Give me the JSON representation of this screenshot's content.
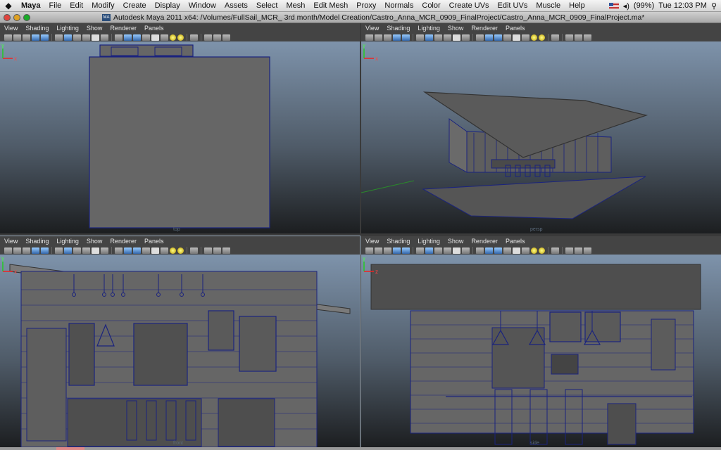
{
  "menubar": {
    "app": "Maya",
    "items": [
      "File",
      "Edit",
      "Modify",
      "Create",
      "Display",
      "Window",
      "Assets",
      "Select",
      "Mesh",
      "Edit Mesh",
      "Proxy",
      "Normals",
      "Color",
      "Create UVs",
      "Edit UVs",
      "Muscle",
      "Help"
    ],
    "battery": "(99%)",
    "clock": "Tue 12:03 PM",
    "search_icon": "magnifier-icon"
  },
  "window": {
    "title": "Autodesk Maya 2011 x64: /Volumes/FullSail_MCR_ 3rd month/Model Creation/Castro_Anna_MCR_0909_FinalProject/Castro_Anna_MCR_0909_FinalProject.ma*",
    "app_icon_text": "MA"
  },
  "panel_menu": [
    "View",
    "Shading",
    "Lighting",
    "Show",
    "Renderer",
    "Panels"
  ],
  "panels": [
    {
      "id": "top-left",
      "camera": "top",
      "axis_x": "x",
      "axis_y": "y"
    },
    {
      "id": "top-right",
      "camera": "persp",
      "axis_x": "x",
      "axis_y": "y"
    },
    {
      "id": "bottom-left",
      "camera": "front",
      "axis_x": "x",
      "axis_y": "y"
    },
    {
      "id": "bottom-right",
      "camera": "side",
      "axis_x": "z",
      "axis_y": "y"
    }
  ],
  "colors": {
    "wire": "#1a237e",
    "mesh": "#666666",
    "bg_top": "#7e93ab",
    "bg_bottom": "#1c1e20"
  }
}
